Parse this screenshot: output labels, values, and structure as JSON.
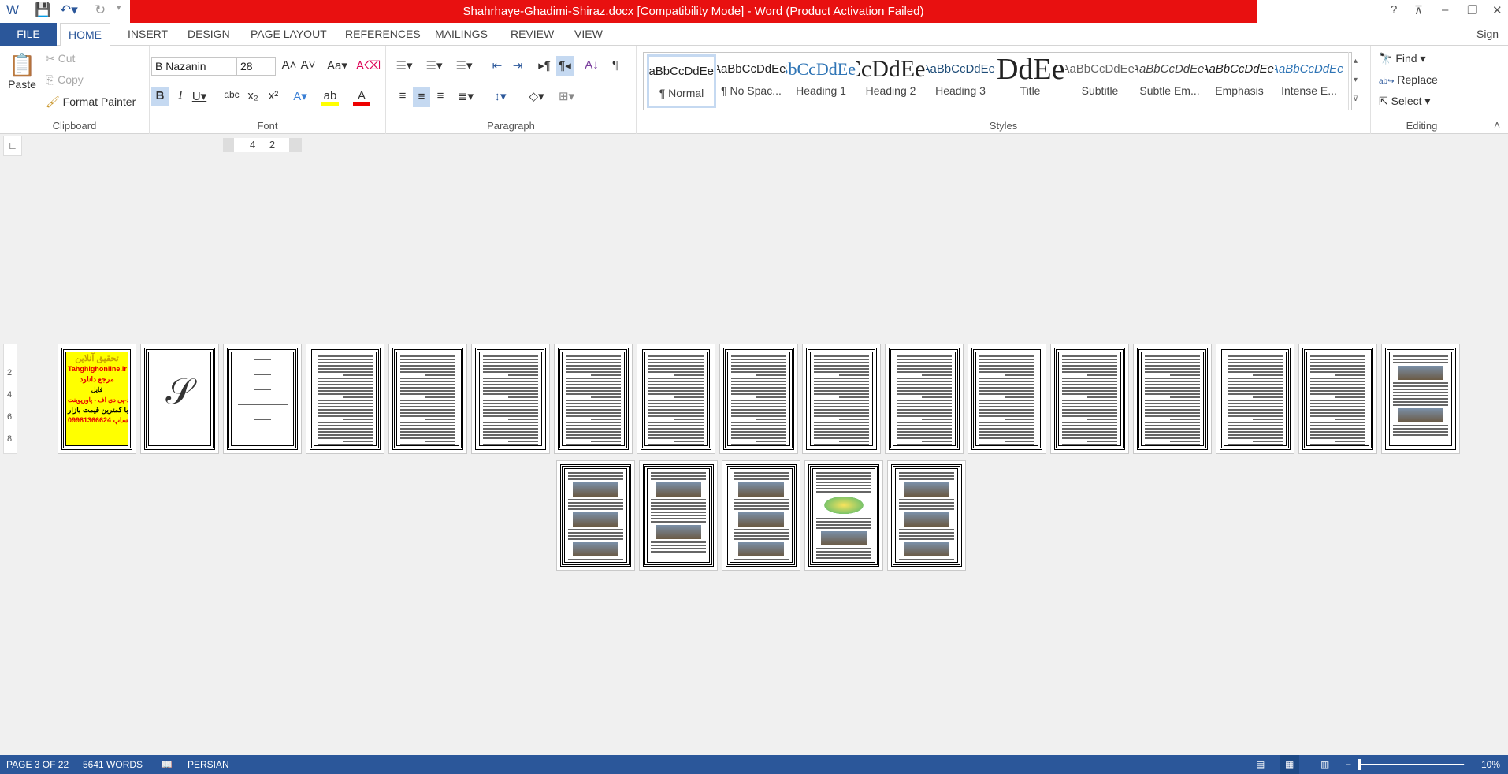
{
  "window": {
    "title": "Shahrhaye-Ghadimi-Shiraz.docx [Compatibility Mode] -  Word (Product Activation Failed)",
    "sign_in": "Sign in",
    "help": "?",
    "accent": "#2b579a",
    "title_color": "#e81010"
  },
  "tabs": [
    "FILE",
    "HOME",
    "INSERT",
    "DESIGN",
    "PAGE LAYOUT",
    "REFERENCES",
    "MAILINGS",
    "REVIEW",
    "VIEW"
  ],
  "clipboard": {
    "paste": "Paste",
    "cut": "Cut",
    "copy": "Copy",
    "format_painter": "Format Painter",
    "label": "Clipboard"
  },
  "font": {
    "name": "B Nazanin",
    "size": "28",
    "label": "Font"
  },
  "paragraph": {
    "label": "Paragraph"
  },
  "styles": {
    "label": "Styles",
    "items": [
      {
        "preview": "AaBbCcDdEe",
        "name": "¶ Normal"
      },
      {
        "preview": "AaBbCcDdEe",
        "name": "¶ No Spac..."
      },
      {
        "preview": "AaBbCcDdEe",
        "name": "Heading 1"
      },
      {
        "preview": "AaBbCcDdEe",
        "name": "Heading 2"
      },
      {
        "preview": "AaBbCcDdEe",
        "name": "Heading 3"
      },
      {
        "preview": "AaBbCcDdEe",
        "name": "Title"
      },
      {
        "preview": "AaBbCcDdEe",
        "name": "Subtitle"
      },
      {
        "preview": "AaBbCcDdEe",
        "name": "Subtle Em..."
      },
      {
        "preview": "AaBbCcDdEe",
        "name": "Emphasis"
      },
      {
        "preview": "AaBbCcDdEe",
        "name": "Intense E..."
      }
    ]
  },
  "editing": {
    "find": "Find",
    "replace": "Replace",
    "select": "Select",
    "label": "Editing"
  },
  "ruler": {
    "marks": [
      "4",
      "2"
    ],
    "vmarks": [
      "2",
      "4",
      "6",
      "8"
    ]
  },
  "cover": {
    "lines": [
      "تحقیق آنلاین",
      "Tahghighonline.ir",
      "مرجع دانلود",
      "فایل",
      "ورد-پی دی اف - پاورپوینت",
      "با کمترین قیمت بازار",
      "09981366624 واتساپ"
    ]
  },
  "pages": [
    "cover",
    "logo",
    "titlepage",
    "text",
    "text",
    "text",
    "text",
    "text",
    "text",
    "text",
    "text",
    "text",
    "text",
    "text",
    "text",
    "text",
    "image1",
    "image2",
    "image3",
    "image2",
    "map",
    "image2"
  ],
  "status": {
    "page": "PAGE 3 OF 22",
    "words": "5641 WORDS",
    "language": "PERSIAN",
    "zoom": "10%",
    "zoom_level_percent": 10
  }
}
